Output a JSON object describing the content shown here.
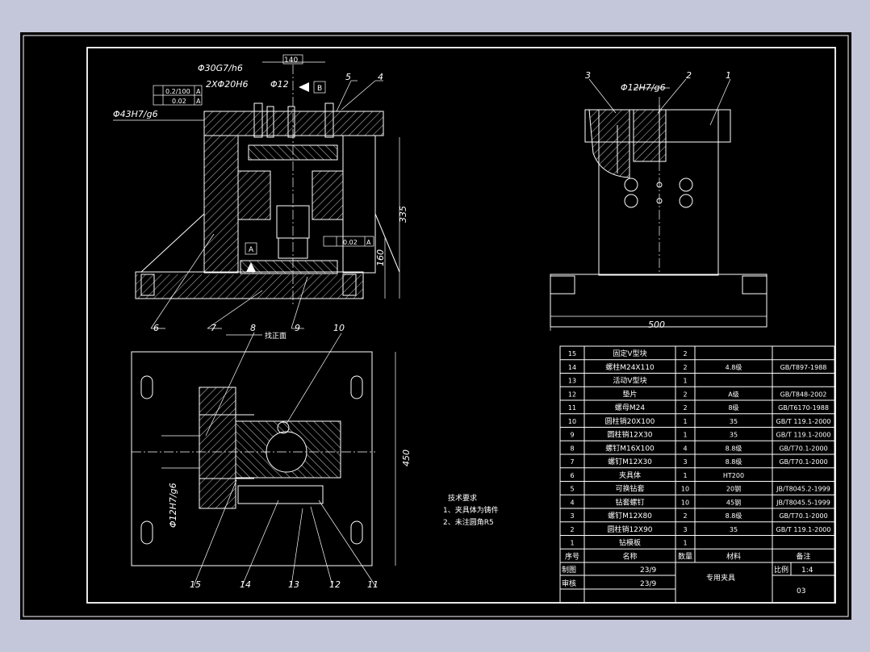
{
  "drawing": {
    "title": "专用夹具",
    "scale_label": "比例",
    "scale_value": "1:4",
    "drawing_no": "03",
    "drawn_label": "制图",
    "drawn_date": "23/9",
    "checked_label": "审核",
    "checked_date": "23/9"
  },
  "front_view": {
    "dims": {
      "d30": "Φ30G7/h6",
      "w140": "140",
      "d20": "2XΦ20H6",
      "d12": "Φ12",
      "d43": "Φ43H7/g6",
      "tol1": "0.2/100",
      "tol2": "0.02",
      "datumA": "A",
      "datumB": "B",
      "h335": "335",
      "h160": "160",
      "par": "0.02"
    },
    "labels": [
      "5",
      "4",
      "6",
      "7",
      "9"
    ]
  },
  "side_view": {
    "dims": {
      "d12": "Φ12H7/g6",
      "w500": "500"
    },
    "labels": [
      "3",
      "2",
      "1"
    ]
  },
  "top_view": {
    "dims": {
      "d12": "Φ12H7/g6",
      "h450": "450"
    },
    "labels": [
      "8",
      "10",
      "15",
      "14",
      "13",
      "12",
      "11"
    ],
    "note_face": "找正面"
  },
  "tech_req": {
    "title": "技术要求",
    "line1": "1、夹具体为铸件",
    "line2": "2、未注圆角R5"
  },
  "bom": {
    "rows": [
      {
        "no": "15",
        "name": "固定V型块",
        "qty": "2",
        "mat": "",
        "std": ""
      },
      {
        "no": "14",
        "name": "螺柱M24X110",
        "qty": "2",
        "mat": "4.8级",
        "std": "GB/T897-1988"
      },
      {
        "no": "13",
        "name": "活动V型块",
        "qty": "1",
        "mat": "",
        "std": ""
      },
      {
        "no": "12",
        "name": "垫片",
        "qty": "2",
        "mat": "A级",
        "std": "GB/T848-2002"
      },
      {
        "no": "11",
        "name": "螺母M24",
        "qty": "2",
        "mat": "8级",
        "std": "GB/T6170-1988"
      },
      {
        "no": "10",
        "name": "圆柱销20X100",
        "qty": "1",
        "mat": "35",
        "std": "GB/T 119.1-2000"
      },
      {
        "no": "9",
        "name": "圆柱销12X30",
        "qty": "1",
        "mat": "35",
        "std": "GB/T 119.1-2000"
      },
      {
        "no": "8",
        "name": "螺钉M16X100",
        "qty": "4",
        "mat": "8.8级",
        "std": "GB/T70.1-2000"
      },
      {
        "no": "7",
        "name": "螺钉M12X30",
        "qty": "3",
        "mat": "8.8级",
        "std": "GB/T70.1-2000"
      },
      {
        "no": "6",
        "name": "夹具体",
        "qty": "1",
        "mat": "HT200",
        "std": ""
      },
      {
        "no": "5",
        "name": "可换钻套",
        "qty": "10",
        "mat": "20钢",
        "std": "JB/T8045.2-1999"
      },
      {
        "no": "4",
        "name": "钻套螺钉",
        "qty": "10",
        "mat": "45钢",
        "std": "JB/T8045.5-1999"
      },
      {
        "no": "3",
        "name": "螺钉M12X80",
        "qty": "2",
        "mat": "8.8级",
        "std": "GB/T70.1-2000"
      },
      {
        "no": "2",
        "name": "圆柱销12X90",
        "qty": "3",
        "mat": "35",
        "std": "GB/T 119.1-2000"
      },
      {
        "no": "1",
        "name": "钻模板",
        "qty": "1",
        "mat": "",
        "std": ""
      }
    ],
    "header": {
      "no": "序号",
      "name": "名称",
      "qty": "数量",
      "mat": "材料",
      "std": "备注"
    }
  }
}
